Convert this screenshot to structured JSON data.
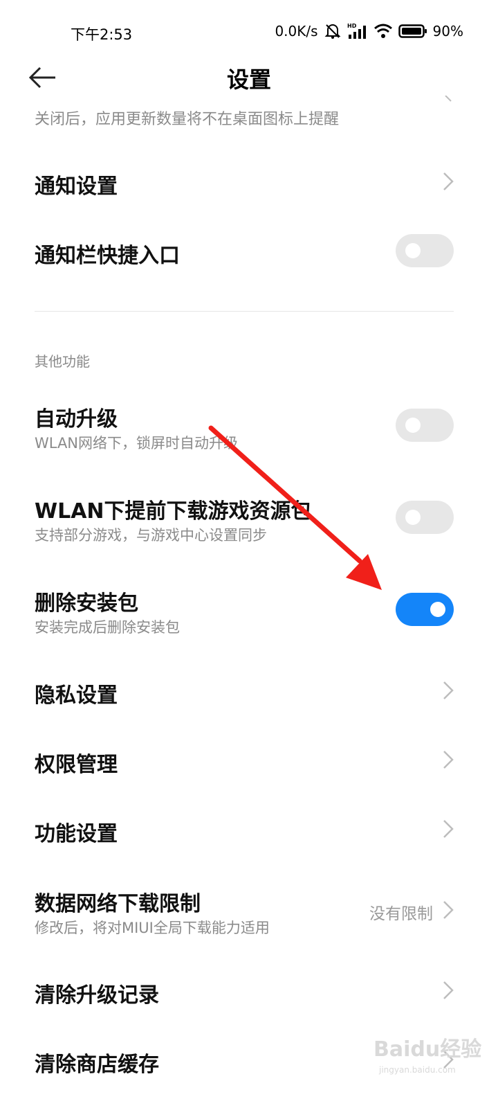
{
  "status": {
    "time": "下午2:53",
    "speed": "0.0K/s",
    "battery": "90%",
    "icons": [
      "mute-bell-icon",
      "hd-signal-icon",
      "wifi-icon",
      "battery-icon"
    ]
  },
  "header": {
    "title": "设置"
  },
  "partial": {
    "subtitle": "关闭后，应用更新数量将不在桌面图标上提醒"
  },
  "rows_top": {
    "notify_settings": "通知设置",
    "notify_shortcut": "通知栏快捷入口"
  },
  "section": {
    "title": "其他功能"
  },
  "rows": {
    "auto_upgrade": {
      "label": "自动升级",
      "sub": "WLAN网络下，锁屏时自动升级",
      "on": false
    },
    "wlan_preload": {
      "label": "WLAN下提前下载游戏资源包",
      "sub": "支持部分游戏，与游戏中心设置同步",
      "on": false
    },
    "delete_pkg": {
      "label": "删除安装包",
      "sub": "安装完成后删除安装包",
      "on": true
    },
    "privacy": {
      "label": "隐私设置"
    },
    "permissions": {
      "label": "权限管理"
    },
    "features": {
      "label": "功能设置"
    },
    "data_limit": {
      "label": "数据网络下载限制",
      "sub": "修改后，将对MIUI全局下载能力适用",
      "value": "没有限制"
    },
    "clear_records": {
      "label": "清除升级记录"
    },
    "clear_cache": {
      "label": "清除商店缓存"
    }
  },
  "watermark": {
    "text": "Baidu经验",
    "url": "jingyan.baidu.com"
  },
  "colors": {
    "accent": "#1485f9",
    "arrow": "#f0201a",
    "toggle_off": "#e7e7e7"
  }
}
